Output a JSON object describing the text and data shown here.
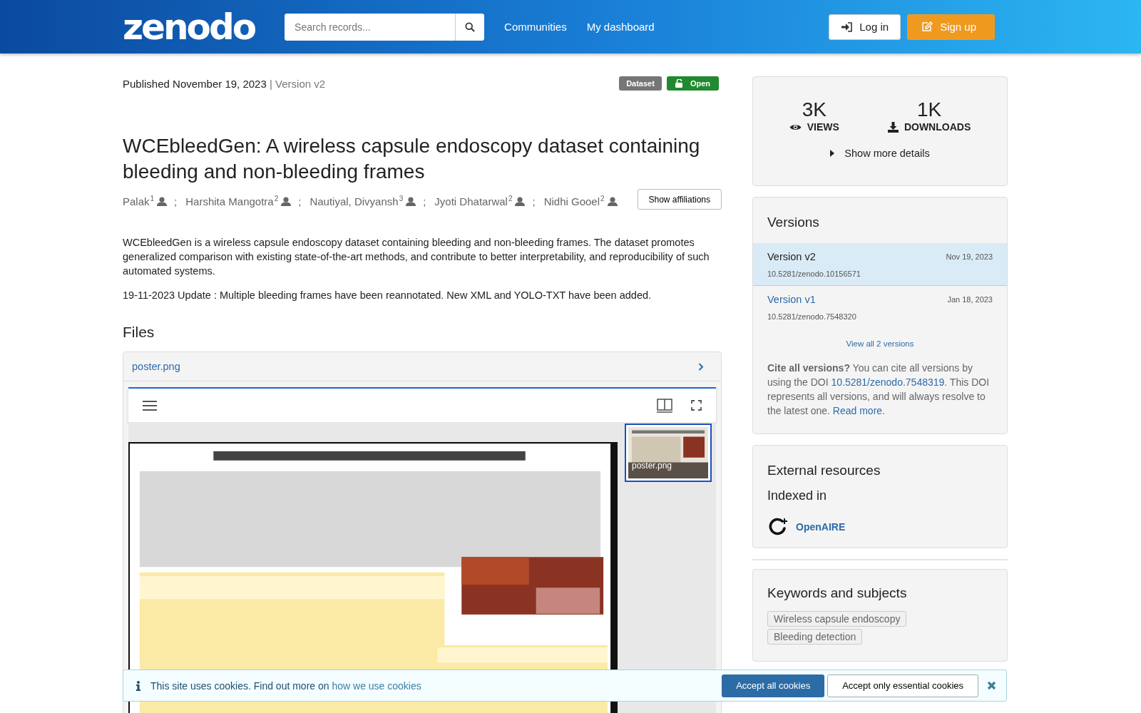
{
  "header": {
    "logo": "zenodo",
    "search": {
      "placeholder": "Search records..."
    },
    "nav": [
      "Communities",
      "My dashboard"
    ],
    "login": "Log in",
    "signup": "Sign up"
  },
  "record": {
    "published": "Published November 19, 2023",
    "version_separator": "|",
    "version": "Version v2",
    "badges": [
      {
        "label": "Dataset",
        "kind": "type"
      },
      {
        "label": "Open",
        "kind": "access"
      }
    ],
    "title": "WCEbleedGen: A wireless capsule endoscopy dataset containing bleeding and non-bleeding frames",
    "authors": [
      {
        "name": "Palak",
        "affiliation": "1"
      },
      {
        "name": "Harshita Mangotra",
        "affiliation": "2"
      },
      {
        "name": "Nautiyal, Divyansh",
        "affiliation": "3"
      },
      {
        "name": "Jyoti Dhatarwal",
        "affiliation": "2"
      },
      {
        "name": "Nidhi Gooel",
        "affiliation": "2"
      }
    ],
    "separator": ";",
    "show_affiliations": "Show affiliations",
    "description": [
      "WCEbleedGen is a wireless capsule endoscopy dataset containing bleeding and non-bleeding frames. The dataset promotes generalized comparison with existing state-of-the-art methods, and contribute to better interpretability, and reproducibility of such automated systems.",
      "19-11-2023 Update : Multiple bleeding frames have been reannotated. New XML and YOLO-TXT have been added."
    ]
  },
  "files": {
    "heading": "Files",
    "file": "poster.png",
    "preview": {
      "kind": "picture",
      "thumbnail_label": "poster.png"
    }
  },
  "stats": [
    {
      "value": "3K",
      "label": "VIEWS",
      "kind": "views"
    },
    {
      "value": "1K",
      "label": "DOWNLOADS",
      "kind": "downloads"
    }
  ],
  "show_more": "Show more details",
  "versions": {
    "heading": "Versions",
    "items": [
      {
        "label": "Version v2",
        "date": "Nov 19, 2023",
        "doi": "10.5281/zenodo.10156571",
        "selected": true
      },
      {
        "label": "Version v1",
        "date": "Jan 18, 2023",
        "doi": "10.5281/zenodo.7548320",
        "selected": false
      }
    ],
    "view_all": "View all 2 versions",
    "cite": "**Cite all versions?** You can cite all versions by using the DOI ",
    "cite_doi": "10.5281/zenodo.7548319",
    "cite_rest": ". This DOI represents all versions, and will always resolve to the latest one. ",
    "read_more": "Read more",
    "cite_end": "."
  },
  "external": {
    "heading": "External resources",
    "subheading": "Indexed in",
    "link": "OpenAIRE"
  },
  "keywords": {
    "heading": "Keywords and subjects",
    "items": [
      "Wireless capsule endoscopy",
      "Bleeding detection"
    ]
  },
  "cookie_banner": {
    "text": "This site uses cookies. Find out more on ",
    "link": "how we use cookies",
    "accept_all": "Accept all cookies",
    "accept_essential": "Accept only essential cookies"
  }
}
